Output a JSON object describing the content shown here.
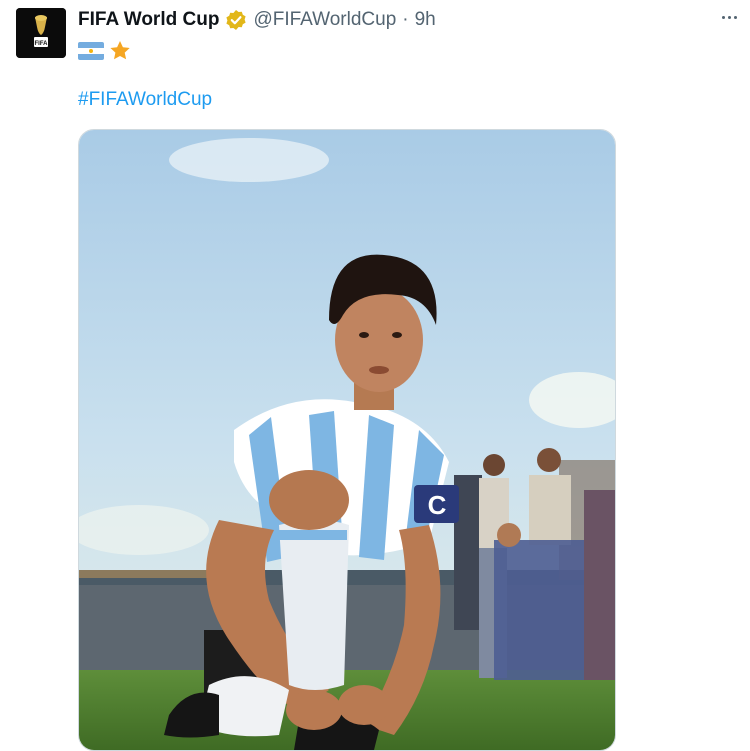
{
  "tweet": {
    "author_name": "FIFA World Cup",
    "handle": "@FIFAWorldCup",
    "separator": "·",
    "time": "9h",
    "body_emojis": [
      "flag-argentina",
      "star"
    ],
    "hashtag": "#FIFAWorldCup",
    "avatar_text": "FIFA",
    "media_armband_letter": "C"
  },
  "icons": {
    "verified": "verified-badge-icon",
    "more": "more-options-icon"
  },
  "colors": {
    "verified_gold": "#e2b719",
    "link_blue": "#1d9bf0",
    "secondary_text": "#536471"
  }
}
